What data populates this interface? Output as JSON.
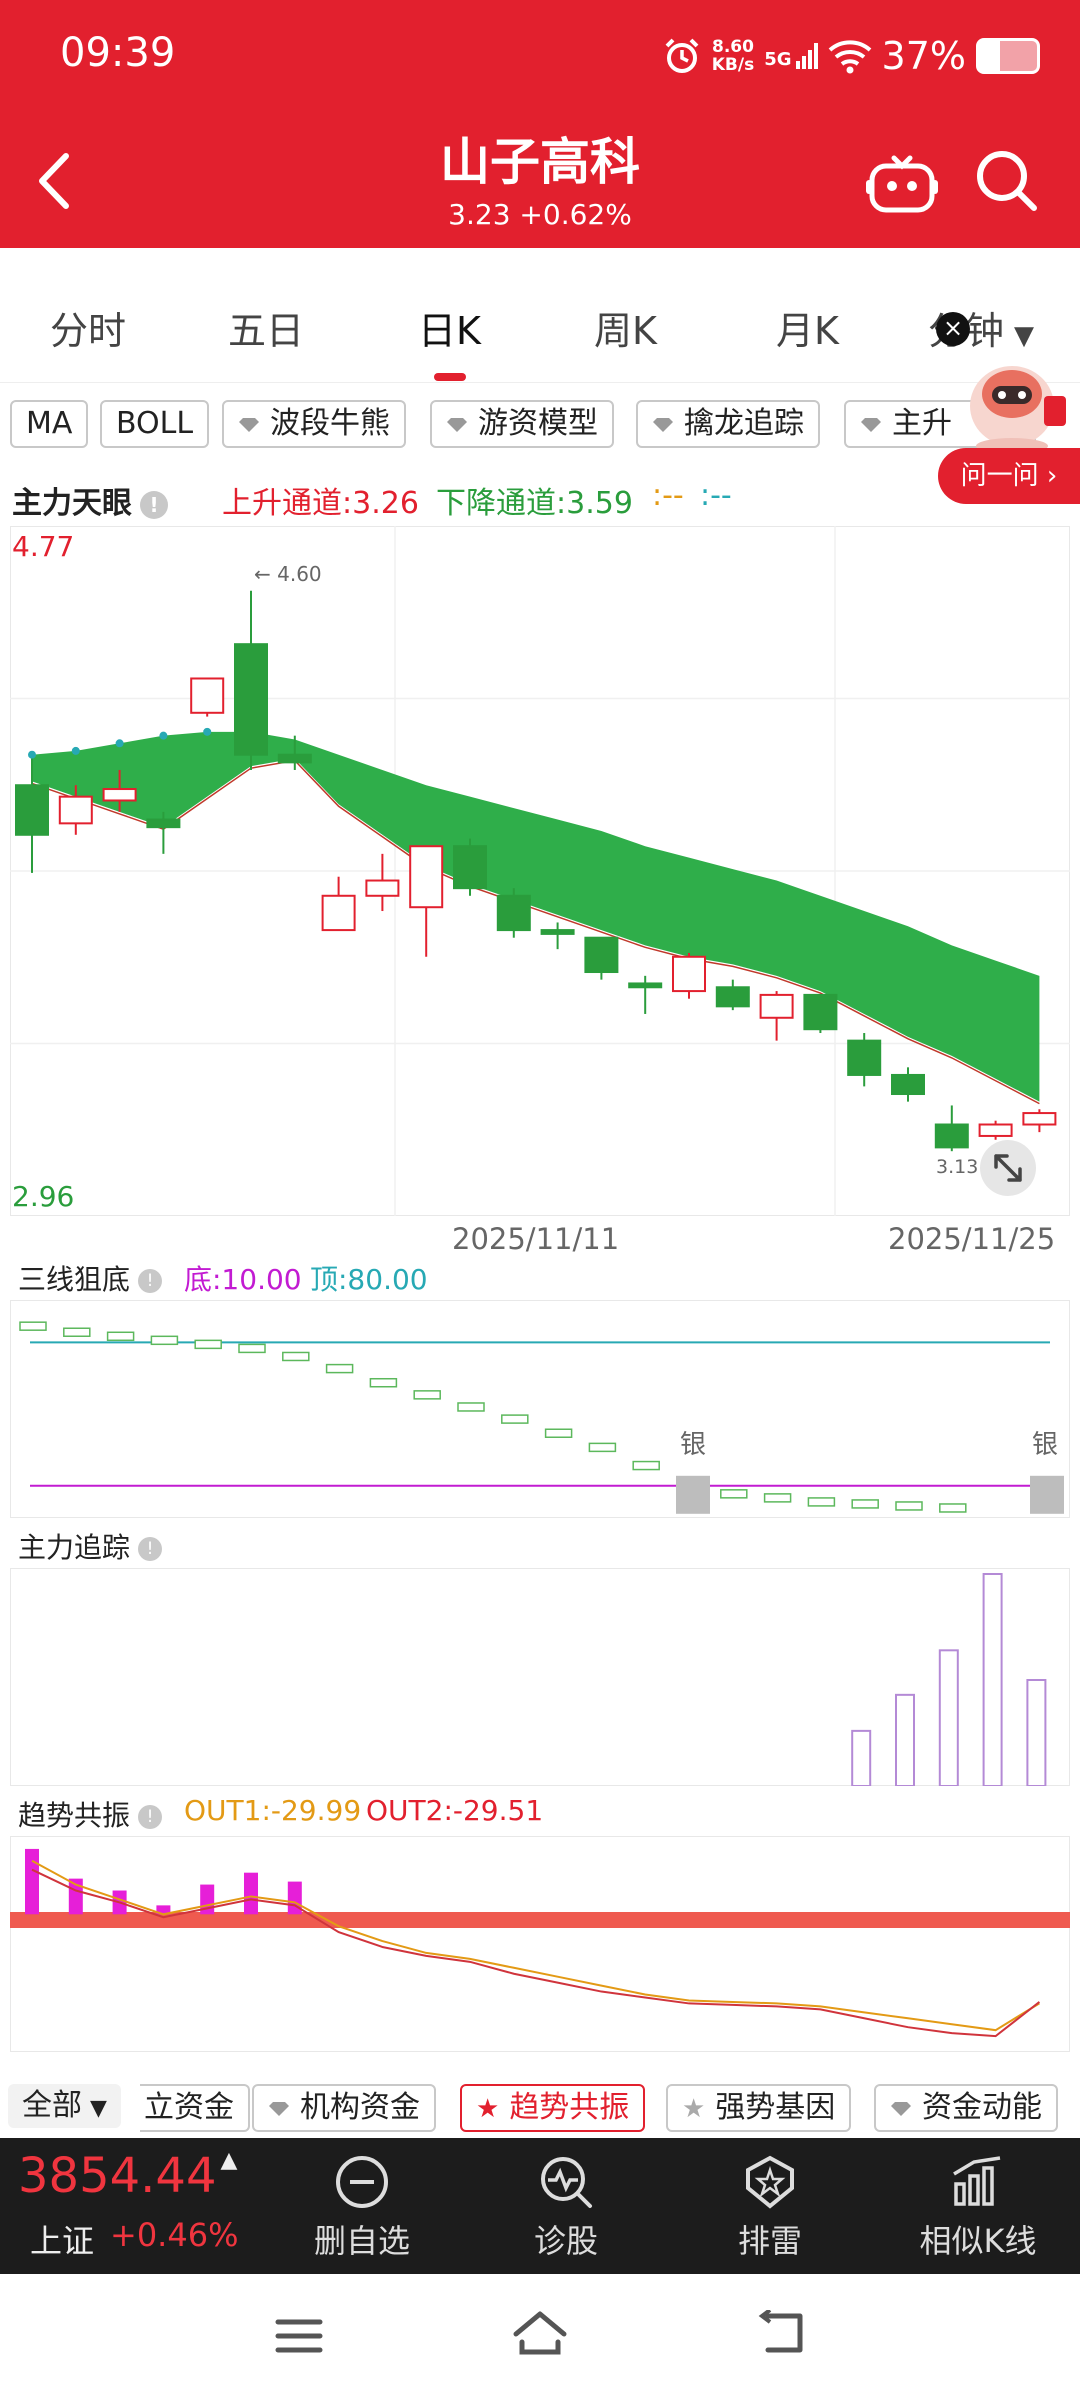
{
  "status_bar": {
    "time": "09:39",
    "net_speed_top": "8.60",
    "net_speed_unit": "KB/s",
    "network": "5G",
    "battery": "37%"
  },
  "header": {
    "title": "山子高科",
    "subtitle": "3.23 +0.62%"
  },
  "period_tabs": [
    "分时",
    "五日",
    "日K",
    "周K",
    "月K",
    "分钟"
  ],
  "indicator_chips": [
    "MA",
    "BOLL",
    "波段牛熊",
    "游资模型",
    "擒龙追踪",
    "主升"
  ],
  "ask_button": "问一问",
  "main_chart": {
    "name": "主力天眼",
    "up_channel": "上升通道:3.26",
    "down_channel": "下降通道:3.59",
    "extra1": ":--",
    "extra2": ":--",
    "price_high": "4.77",
    "price_low": "2.96",
    "peak_label": "← 4.60",
    "low_label": "3.13",
    "dates": [
      "2025/11/11",
      "2025/11/25"
    ]
  },
  "sub_three_line": {
    "name": "三线狙底",
    "bottom": "底:10.00",
    "top": "顶:80.00",
    "marker": "银"
  },
  "sub_tracking": {
    "name": "主力追踪"
  },
  "sub_trend": {
    "name": "趋势共振",
    "out1": "OUT1:-29.99",
    "out2": "OUT2:-29.51"
  },
  "bottom_chips": {
    "all": "全部",
    "items": [
      "立资金",
      "机构资金",
      "趋势共振",
      "强势基因",
      "资金动能"
    ]
  },
  "index": {
    "value": "3854.44",
    "name": "上证",
    "change": "+0.46%"
  },
  "bottom_actions": [
    "删自选",
    "诊股",
    "排雷",
    "相似K线"
  ],
  "colors": {
    "brand_red": "#e2202e",
    "up_red": "#e2202e",
    "down_green": "#2a9d3c",
    "cyan": "#27a9b4",
    "magenta": "#c21bd2",
    "orange": "#e39a15"
  },
  "chart_data": {
    "type": "candlestick",
    "title": "主力天眼",
    "ylim": [
      2.96,
      4.77
    ],
    "candles": [
      {
        "o": 4.09,
        "c": 3.96,
        "h": 4.16,
        "l": 3.86
      },
      {
        "o": 3.99,
        "c": 4.06,
        "h": 4.09,
        "l": 3.96
      },
      {
        "o": 4.05,
        "c": 4.08,
        "h": 4.13,
        "l": 4.02
      },
      {
        "o": 4.0,
        "c": 3.98,
        "h": 4.02,
        "l": 3.91
      },
      {
        "o": 4.28,
        "c": 4.37,
        "h": 4.37,
        "l": 4.27
      },
      {
        "o": 4.46,
        "c": 4.17,
        "h": 4.6,
        "l": 4.13
      },
      {
        "o": 4.17,
        "c": 4.15,
        "h": 4.22,
        "l": 4.13
      },
      {
        "o": 3.71,
        "c": 3.8,
        "h": 3.85,
        "l": 3.71
      },
      {
        "o": 3.8,
        "c": 3.84,
        "h": 3.91,
        "l": 3.76
      },
      {
        "o": 3.77,
        "c": 3.93,
        "h": 3.93,
        "l": 3.64
      },
      {
        "o": 3.93,
        "c": 3.82,
        "h": 3.95,
        "l": 3.8
      },
      {
        "o": 3.8,
        "c": 3.71,
        "h": 3.82,
        "l": 3.69
      },
      {
        "o": 3.71,
        "c": 3.7,
        "h": 3.73,
        "l": 3.66
      },
      {
        "o": 3.69,
        "c": 3.6,
        "h": 3.69,
        "l": 3.58
      },
      {
        "o": 3.57,
        "c": 3.56,
        "h": 3.59,
        "l": 3.49
      },
      {
        "o": 3.55,
        "c": 3.64,
        "h": 3.65,
        "l": 3.53
      },
      {
        "o": 3.56,
        "c": 3.51,
        "h": 3.58,
        "l": 3.5
      },
      {
        "o": 3.48,
        "c": 3.54,
        "h": 3.55,
        "l": 3.42
      },
      {
        "o": 3.54,
        "c": 3.45,
        "h": 3.54,
        "l": 3.44
      },
      {
        "o": 3.42,
        "c": 3.33,
        "h": 3.44,
        "l": 3.3
      },
      {
        "o": 3.33,
        "c": 3.28,
        "h": 3.35,
        "l": 3.26
      },
      {
        "o": 3.2,
        "c": 3.14,
        "h": 3.25,
        "l": 3.13
      },
      {
        "o": 3.17,
        "c": 3.2,
        "h": 3.21,
        "l": 3.16
      },
      {
        "o": 3.2,
        "c": 3.23,
        "h": 3.24,
        "l": 3.18
      }
    ],
    "band_upper": [
      4.17,
      4.18,
      4.2,
      4.22,
      4.23,
      4.23,
      4.21,
      4.17,
      4.13,
      4.09,
      4.06,
      4.03,
      4.0,
      3.97,
      3.93,
      3.9,
      3.87,
      3.84,
      3.8,
      3.76,
      3.72,
      3.67,
      3.63,
      3.59
    ],
    "band_lower": [
      4.1,
      4.06,
      4.02,
      3.98,
      4.06,
      4.14,
      4.16,
      4.04,
      3.96,
      3.88,
      3.83,
      3.79,
      3.75,
      3.71,
      3.67,
      3.64,
      3.62,
      3.59,
      3.55,
      3.49,
      3.43,
      3.38,
      3.32,
      3.26
    ],
    "three_line_steps": [
      91,
      88,
      86,
      84,
      82,
      80,
      76,
      70,
      63,
      57,
      51,
      45,
      38,
      31,
      22,
      12,
      8,
      6,
      4,
      3,
      2,
      1
    ],
    "three_line_ylim": [
      0,
      100
    ],
    "tracking_bars": [
      0,
      0,
      0,
      0,
      0,
      0,
      0,
      0,
      0,
      0,
      0,
      0,
      0,
      0,
      0,
      0,
      0,
      0,
      0,
      26,
      43,
      64,
      100,
      50
    ],
    "trend_bars": [
      22,
      12,
      8,
      3,
      10,
      14,
      11
    ],
    "trend_out1": [
      18,
      10,
      5,
      0,
      3,
      6,
      4,
      -4,
      -9,
      -13,
      -15,
      -18,
      -21,
      -24,
      -27,
      -29,
      -29.5,
      -30,
      -31,
      -33,
      -35,
      -37,
      -39,
      -29.99
    ],
    "trend_out2": [
      15,
      8,
      4,
      -1,
      2,
      5,
      3,
      -6,
      -11,
      -14,
      -16,
      -20,
      -23,
      -26,
      -28,
      -30,
      -30.5,
      -31,
      -32,
      -35,
      -38,
      -40,
      -41,
      -29.51
    ]
  }
}
